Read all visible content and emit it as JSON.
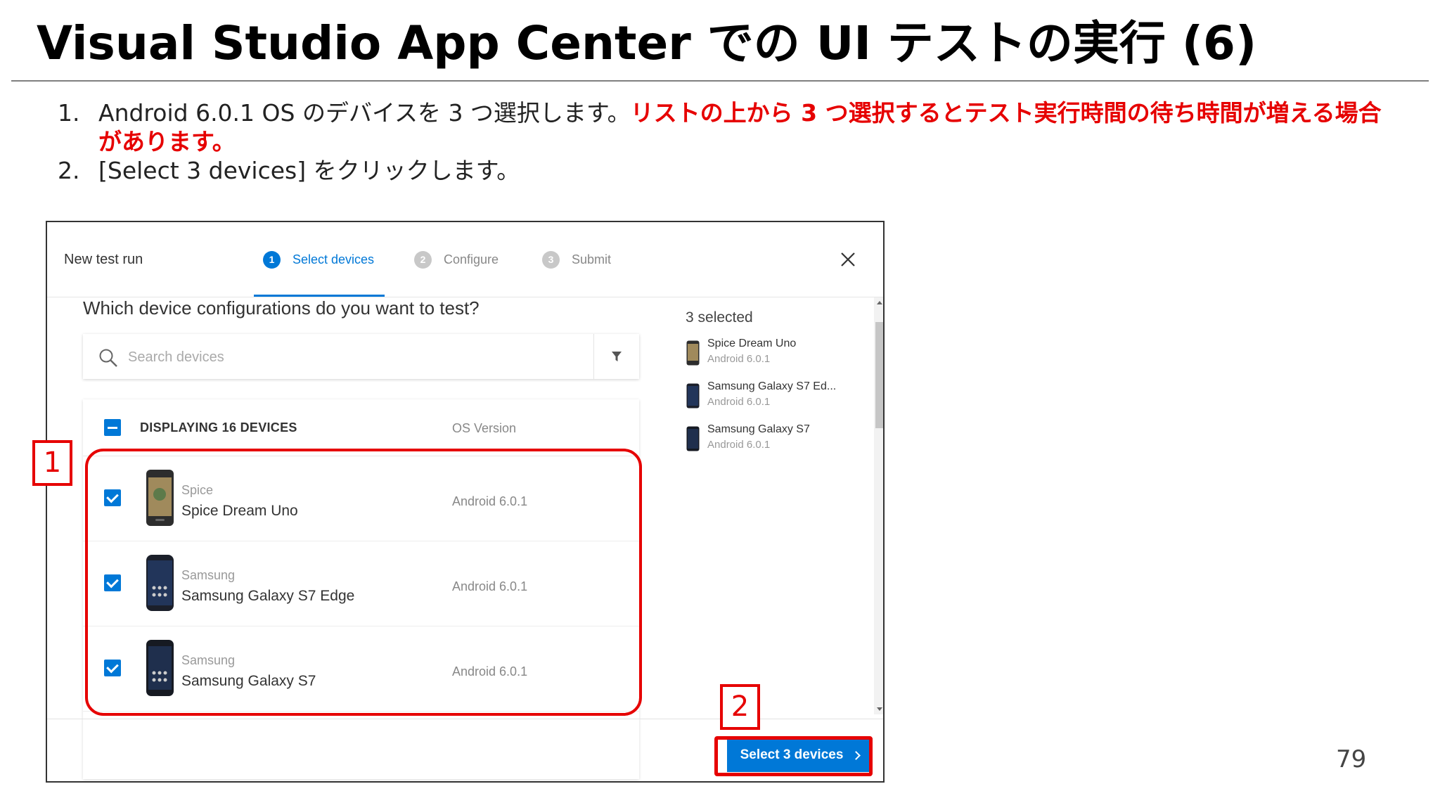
{
  "slide": {
    "title": "Visual Studio App Center での UI テストの実行 (6)",
    "page_number": "79",
    "steps": [
      {
        "number": "1.",
        "text": "Android 6.0.1 OS のデバイスを 3 つ選択します。",
        "emphasis": "リストの上から 3 つ選択するとテスト実行時間の待ち時間が増える場合があります。"
      },
      {
        "number": "2.",
        "text": "[Select 3 devices] をクリックします。",
        "emphasis": ""
      }
    ],
    "callouts": [
      "1",
      "2"
    ]
  },
  "dialog": {
    "title": "New test run",
    "wizard_steps": [
      {
        "number": "1",
        "label": "Select devices",
        "active": true
      },
      {
        "number": "2",
        "label": "Configure",
        "active": false
      },
      {
        "number": "3",
        "label": "Submit",
        "active": false
      }
    ],
    "question": "Which device configurations do you want to test?",
    "search": {
      "placeholder": "Search devices",
      "value": ""
    },
    "list_header": {
      "displaying_label": "DISPLAYING 16 DEVICES",
      "os_column": "OS Version"
    },
    "devices": [
      {
        "maker": "Spice",
        "model": "Spice Dream Uno",
        "os": "Android 6.0.1",
        "checked": true
      },
      {
        "maker": "Samsung",
        "model": "Samsung Galaxy S7 Edge",
        "os": "Android 6.0.1",
        "checked": true
      },
      {
        "maker": "Samsung",
        "model": "Samsung Galaxy S7",
        "os": "Android 6.0.1",
        "checked": true
      }
    ],
    "selected_panel": {
      "count_label": "3 selected",
      "items": [
        {
          "name": "Spice Dream Uno",
          "os": "Android 6.0.1"
        },
        {
          "name": "Samsung Galaxy S7 Ed...",
          "os": "Android 6.0.1"
        },
        {
          "name": "Samsung Galaxy S7",
          "os": "Android 6.0.1"
        }
      ]
    },
    "primary_button": "Select 3 devices"
  },
  "colors": {
    "accent_blue": "#0078d7",
    "annotation_red": "#e60000"
  }
}
